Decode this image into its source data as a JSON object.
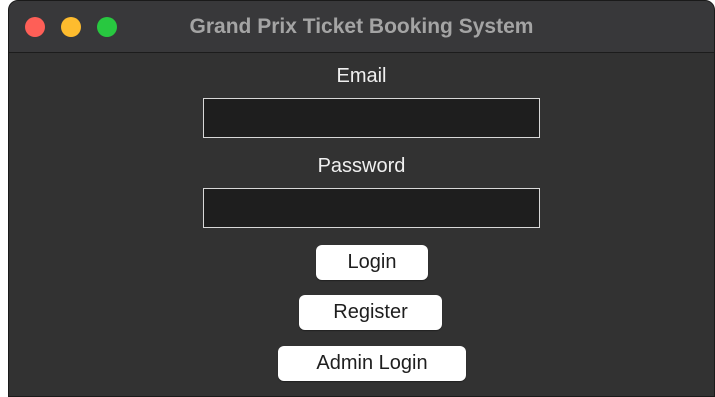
{
  "window": {
    "title": "Grand Prix Ticket Booking System"
  },
  "form": {
    "email_label": "Email",
    "email_value": "",
    "password_label": "Password",
    "password_value": ""
  },
  "buttons": {
    "login": "Login",
    "register": "Register",
    "admin_login": "Admin Login"
  },
  "colors": {
    "background": "#323232",
    "titlebar": "#38383a",
    "close": "#fe5f57",
    "minimize": "#febc2e",
    "zoom": "#28c840",
    "field_background": "#1e1e1e",
    "button_background": "#ffffff"
  }
}
